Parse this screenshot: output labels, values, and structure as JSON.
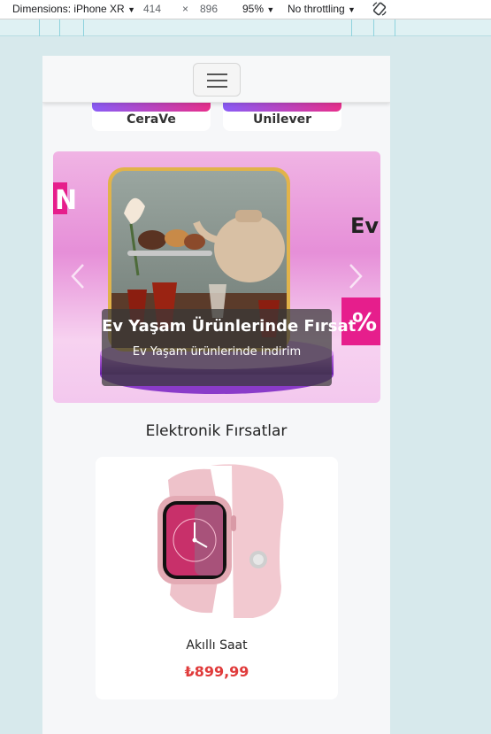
{
  "devtools": {
    "dimensions_label": "Dimensions: iPhone XR",
    "width": "414",
    "times": "×",
    "height": "896",
    "zoom": "95%",
    "throttling": "No throttling"
  },
  "brands": [
    {
      "label": "CeraVe",
      "color_from": "#8a5cf6",
      "color_to": "#e72f8c"
    },
    {
      "label": "Unilever",
      "color_from": "#8a5cf6",
      "color_to": "#e72f8c"
    }
  ],
  "carousel": {
    "title": "Ev Yaşam Ürünlerinde Fırsat",
    "subtitle": "Ev Yaşam ürünlerinde indirim",
    "side_text_right": "Ev",
    "side_text_left": "N",
    "badge": "%"
  },
  "section": {
    "title": "Elektronik Fırsatlar"
  },
  "product": {
    "name": "Akıllı Saat",
    "price": "₺899,99"
  },
  "colors": {
    "price": "#e03b3b",
    "accent_pink": "#e72f8c",
    "accent_purple": "#8a2be2"
  }
}
